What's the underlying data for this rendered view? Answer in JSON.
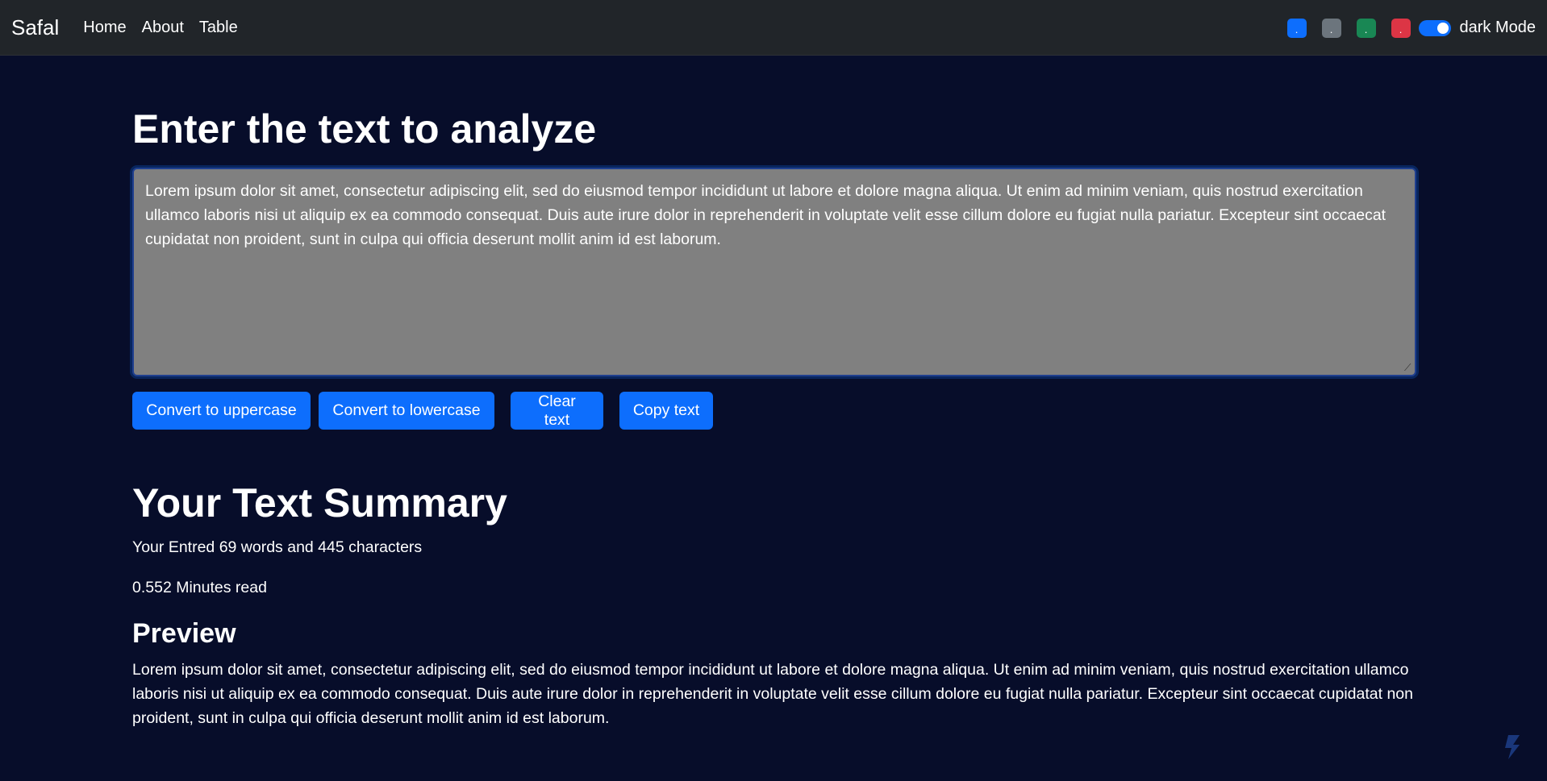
{
  "navbar": {
    "brand": "Safal",
    "links": [
      "Home",
      "About",
      "Table"
    ],
    "swatches": [
      {
        "color": "#0d6efd",
        "label": "."
      },
      {
        "color": "#6c757d",
        "label": "."
      },
      {
        "color": "#198754",
        "label": "."
      },
      {
        "color": "#dc3545",
        "label": "."
      }
    ],
    "mode_toggle": {
      "label": "dark Mode",
      "checked": true
    }
  },
  "main": {
    "heading": "Enter the text to analyze",
    "textarea_value": "Lorem ipsum dolor sit amet, consectetur adipiscing elit, sed do eiusmod tempor incididunt ut labore et dolore magna aliqua. Ut enim ad minim veniam, quis nostrud exercitation ullamco laboris nisi ut aliquip ex ea commodo consequat. Duis aute irure dolor in reprehenderit in voluptate velit esse cillum dolore eu fugiat nulla pariatur. Excepteur sint occaecat cupidatat non proident, sunt in culpa qui officia deserunt mollit anim id est laborum.",
    "buttons": {
      "uppercase": "Convert to uppercase",
      "lowercase": "Convert to lowercase",
      "clear": "Clear text",
      "copy": "Copy text"
    }
  },
  "summary": {
    "title": "Your Text Summary",
    "counts": "Your Entred 69 words and 445 characters",
    "read_time": "0.552 Minutes read",
    "preview_title": "Preview",
    "preview_text": "Lorem ipsum dolor sit amet, consectetur adipiscing elit, sed do eiusmod tempor incididunt ut labore et dolore magna aliqua. Ut enim ad minim veniam, quis nostrud exercitation ullamco laboris nisi ut aliquip ex ea commodo consequat. Duis aute irure dolor in reprehenderit in voluptate velit esse cillum dolore eu fugiat nulla pariatur. Excepteur sint occaecat cupidatat non proident, sunt in culpa qui officia deserunt mollit anim id est laborum."
  },
  "colors": {
    "background": "#070d2a",
    "navbar": "#212529",
    "accent": "#0d6efd",
    "textarea_bg": "#808080"
  },
  "icons": {
    "corner": "corner-logo-icon"
  }
}
